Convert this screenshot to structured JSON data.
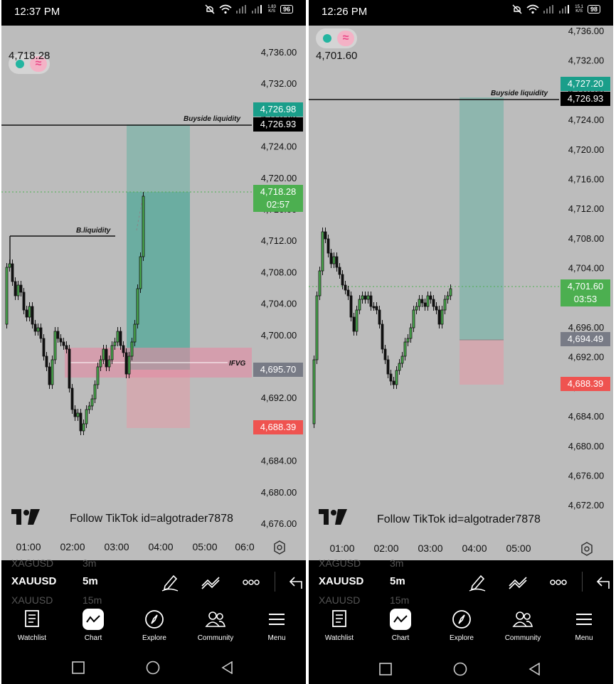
{
  "panels": [
    {
      "status": {
        "time": "12:37 PM",
        "speed": "1.83",
        "speed_unit": "K/S",
        "battery": "96"
      },
      "ohlc": "4,718.28",
      "follow": "Follow TikTok id=algotrader7878",
      "price_axis": [
        "4,736.00",
        "4,732.00",
        "4,728.00",
        "4,724.00",
        "4,720.00",
        "4,716.00",
        "4,712.00",
        "4,708.00",
        "4,704.00",
        "4,700.00",
        "4,696.00",
        "4,692.00",
        "4,688.00",
        "4,684.00",
        "4,680.00",
        "4,676.00"
      ],
      "time_axis": [
        "01:00",
        "02:00",
        "03:00",
        "04:00",
        "05:00",
        "06:0"
      ],
      "badges": {
        "tp": "4,726.98",
        "liquidity": "4,726.93",
        "current": "4,718.28",
        "countdown": "02:57",
        "fvg": "4,695.70",
        "stop": "4,688.39"
      },
      "labels": {
        "buyside": "Buyside liquidity",
        "bliq": "B.liquidity",
        "ifvg": "IFVG"
      },
      "colors": {
        "green": "#4caf50",
        "teal": "#1a9e8a",
        "red": "#ef5350",
        "gray": "#787b86"
      },
      "toolbar": {
        "ghost_top_sym": "XAGUSD",
        "ghost_top_tf": "3m",
        "symbol": "XAUUSD",
        "timeframe": "5m",
        "ghost_bottom_sym": "XAUUSD",
        "ghost_bottom_tf": "15m"
      },
      "nav": [
        {
          "label": "Watchlist",
          "icon": "watchlist-icon"
        },
        {
          "label": "Chart",
          "icon": "chart-icon"
        },
        {
          "label": "Explore",
          "icon": "compass-icon"
        },
        {
          "label": "Community",
          "icon": "community-icon"
        },
        {
          "label": "Menu",
          "icon": "menu-icon"
        }
      ]
    },
    {
      "status": {
        "time": "12:26 PM",
        "speed": "15.1",
        "speed_unit": "K/S",
        "battery": "98"
      },
      "ohlc": "4,701.60",
      "follow": "Follow TikTok id=algotrader7878",
      "price_axis": [
        "4,736.00",
        "4,732.00",
        "4,728.00",
        "4,724.00",
        "4,720.00",
        "4,716.00",
        "4,712.00",
        "4,708.00",
        "4,704.00",
        "4,700.00",
        "4,696.00",
        "4,692.00",
        "4,688.00",
        "4,684.00",
        "4,680.00",
        "4,676.00",
        "4,672.00"
      ],
      "time_axis": [
        "01:00",
        "02:00",
        "03:00",
        "04:00",
        "05:00"
      ],
      "badges": {
        "tp": "4,727.20",
        "liquidity": "4,726.93",
        "current": "4,701.60",
        "countdown": "03:53",
        "entry": "4,694.49",
        "stop": "4,688.39"
      },
      "labels": {
        "buyside": "Buyside liquidity"
      },
      "colors": {
        "green": "#4caf50",
        "teal": "#1a9e8a",
        "red": "#ef5350",
        "gray": "#787b86"
      },
      "toolbar": {
        "ghost_top_sym": "XAGUSD",
        "ghost_top_tf": "3m",
        "symbol": "XAUUSD",
        "timeframe": "5m",
        "ghost_bottom_sym": "XAUUSD",
        "ghost_bottom_tf": "15m"
      },
      "nav": [
        {
          "label": "Watchlist",
          "icon": "watchlist-icon"
        },
        {
          "label": "Chart",
          "icon": "chart-icon"
        },
        {
          "label": "Explore",
          "icon": "compass-icon"
        },
        {
          "label": "Community",
          "icon": "community-icon"
        },
        {
          "label": "Menu",
          "icon": "menu-icon"
        }
      ]
    }
  ]
}
